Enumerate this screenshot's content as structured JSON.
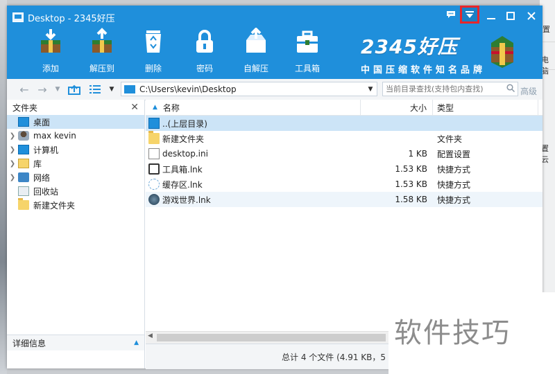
{
  "window": {
    "title": "Desktop - 2345好压",
    "controls": [
      "chat-icon",
      "dropdown-menu-icon",
      "minimize-icon",
      "maximize-icon",
      "close-icon"
    ]
  },
  "toolbar": {
    "items": [
      {
        "label": "添加",
        "icon": "add-archive-icon"
      },
      {
        "label": "解压到",
        "icon": "extract-to-icon"
      },
      {
        "label": "删除",
        "icon": "recycle-icon"
      },
      {
        "label": "密码",
        "icon": "lock-icon"
      },
      {
        "label": "自解压",
        "icon": "self-extract-icon"
      },
      {
        "label": "工具箱",
        "icon": "toolbox-icon"
      }
    ]
  },
  "brand": {
    "name": "2345好压",
    "slogan": "中国压缩软件知名品牌"
  },
  "address": {
    "path": "C:\\Users\\kevin\\Desktop",
    "search_placeholder": "当前目录查找(支持包内查找)",
    "advanced_label": "高级"
  },
  "sidebar": {
    "title": "文件夹",
    "items": [
      {
        "label": "桌面",
        "icon": "desktop-icon",
        "selected": true,
        "expand": false
      },
      {
        "label": "max kevin",
        "icon": "user-icon",
        "expand": true
      },
      {
        "label": "计算机",
        "icon": "computer-icon",
        "expand": true
      },
      {
        "label": "库",
        "icon": "library-icon",
        "expand": true
      },
      {
        "label": "网络",
        "icon": "network-icon",
        "expand": true
      },
      {
        "label": "回收站",
        "icon": "recycle-bin-icon",
        "expand": false
      },
      {
        "label": "新建文件夹",
        "icon": "folder-icon",
        "expand": false
      }
    ],
    "details_label": "详细信息"
  },
  "filelist": {
    "columns": {
      "name": "名称",
      "size": "大小",
      "type": "类型"
    },
    "rows": [
      {
        "name": "..(上层目录)",
        "size": "",
        "type": "",
        "icon": "parent-dir-icon"
      },
      {
        "name": "新建文件夹",
        "size": "",
        "type": "文件夹",
        "icon": "folder-icon"
      },
      {
        "name": "desktop.ini",
        "size": "1 KB",
        "type": "配置设置",
        "icon": "ini-file-icon"
      },
      {
        "name": "工具箱.lnk",
        "size": "1.53 KB",
        "type": "快捷方式",
        "icon": "toolbox-shortcut-icon"
      },
      {
        "name": "缓存区.lnk",
        "size": "1.53 KB",
        "type": "快捷方式",
        "icon": "cache-shortcut-icon"
      },
      {
        "name": "游戏世界.lnk",
        "size": "1.58 KB",
        "type": "快捷方式",
        "icon": "game-shortcut-icon"
      }
    ]
  },
  "status": {
    "text": "总计 4 个文件 (4.91 KB，5"
  },
  "background": {
    "fragments": [
      "置",
      "电脑",
      "置云"
    ]
  },
  "watermark": {
    "text": "软件技巧"
  },
  "colors": {
    "titlebar": "#1f8fdb",
    "selection": "#cce4f7",
    "highlight_box": "#e8262a"
  }
}
